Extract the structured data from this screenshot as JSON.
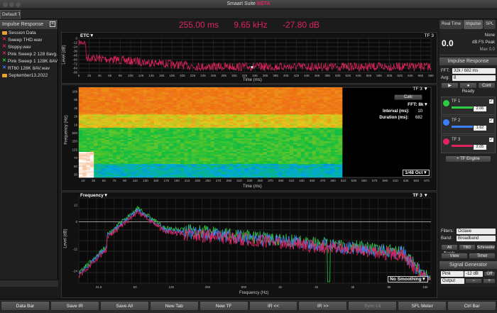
{
  "window": {
    "title": "Smaart Suite",
    "title_badge": "BETA"
  },
  "tabs": [
    "Default Tab"
  ],
  "readout": {
    "time": "255.00 ms",
    "freq": "9.65 kHz",
    "level": "-27.80 dB"
  },
  "left_panel": {
    "header": "Impulse Response",
    "items": [
      {
        "label": "Session Data",
        "marker": "folder",
        "color": "#e6a22e"
      },
      {
        "label": "Sweep THD.wav",
        "marker": "x",
        "color": "#e0245e"
      },
      {
        "label": "Sloppy.wav",
        "marker": "x",
        "color": "#e0245e"
      },
      {
        "label": "Pink Sweep 2 128 8avg.wav",
        "marker": "x",
        "color": "#e0245e"
      },
      {
        "label": "Pink Sweep 1 128K 8AVG.wav",
        "marker": "x",
        "color": "#2ecc40"
      },
      {
        "label": "RT60 128K 8AV.wav",
        "marker": "x",
        "color": "#3a7fff"
      },
      {
        "label": "September13.2022",
        "marker": "folder",
        "color": "#e6a22e"
      }
    ]
  },
  "etc_plot": {
    "title": "ETC",
    "trace": "TF 3",
    "ylabel": "Level (dB)",
    "xlabel": "Time (ms)",
    "yticks": [
      "0",
      "-12",
      "-24",
      "-36",
      "-48",
      "-60",
      "-72",
      "-84",
      "-96"
    ],
    "xticks": [
      "5",
      "25",
      "45",
      "65",
      "85",
      "105",
      "125",
      "145",
      "165",
      "185",
      "205",
      "225",
      "245",
      "265",
      "285",
      "305",
      "325",
      "345",
      "365",
      "385",
      "405",
      "425",
      "445",
      "465",
      "485",
      "505",
      "525",
      "545",
      "565",
      "585",
      "605",
      "625",
      "645",
      "665",
      "685"
    ]
  },
  "spectrograph": {
    "trace": "TF 3",
    "calc_label": "Calc",
    "fft_label": "FFT: 8k",
    "interval_label": "Interval (ms):",
    "interval_value": "10",
    "duration_label": "Duration (ms):",
    "duration_value": "682",
    "smoothing": "1/48 Oct",
    "ylabel": "Frequency (Hz)",
    "xlabel": "Time (ms)",
    "yticks": [
      "16k",
      "8k",
      "4k",
      "2k",
      "1k",
      "500",
      "250",
      "125",
      "70",
      "50",
      "30"
    ],
    "xticks": [
      "10",
      "30",
      "50",
      "70",
      "90",
      "110",
      "130",
      "150",
      "170",
      "190",
      "210",
      "230",
      "250",
      "270",
      "290",
      "310",
      "330",
      "350",
      "370",
      "390",
      "410",
      "430",
      "450",
      "470",
      "490",
      "510",
      "530",
      "550",
      "570",
      "590",
      "610",
      "630",
      "650",
      "670"
    ]
  },
  "freq_plot": {
    "title": "Frequency",
    "trace": "TF 3",
    "smoothing": "No Smoothing",
    "ylabel": "Level (dB)",
    "xlabel": "Frequency (Hz)",
    "yticks": [
      "12",
      "0",
      "-12",
      "-24"
    ],
    "xticks": [
      "31.5",
      "63",
      "125",
      "250",
      "500",
      "1k",
      "2k",
      "4k",
      "8k",
      "16k"
    ],
    "series_colors": [
      "#2ecc40",
      "#3a7fff",
      "#e0245e"
    ]
  },
  "right_panel": {
    "tabs": [
      "Real Time",
      "Impulse",
      "SPL"
    ],
    "spl": {
      "value": "0.0",
      "none": "None",
      "unit": "dB FS Peak",
      "max": "Max 0.0"
    },
    "section_title": "Impulse Response",
    "fft_label": "FFT:",
    "fft_value": "32k / 682 ms",
    "avg_label": "Avg:",
    "avg_value": "8",
    "cont_label": "Cont",
    "status": "Ready",
    "traces": [
      {
        "name": "TF 1",
        "value": "2.06",
        "color": "#2ecc40"
      },
      {
        "name": "TF 2",
        "value": "1.62",
        "color": "#3a7fff"
      },
      {
        "name": "TF 3",
        "value": "2.05",
        "color": "#e0245e"
      }
    ],
    "tf_engine": "+ TF Engine",
    "filters_label": "Filters:",
    "filters_value": "Octave",
    "band_label": "Band:",
    "band_value": "Broadband",
    "band_tabs": [
      "All Bands",
      "TBD",
      "Schroeder"
    ],
    "view_tabs": [
      "View",
      "Timer"
    ],
    "signal_generator": "Signal Generator",
    "gen_signal": "Pink Noise",
    "gen_level": "-12 dB",
    "gen_state": "Off",
    "gen_output": "Output"
  },
  "bottom_bar": [
    "Data Bar",
    "Save IR",
    "Save All",
    "New Tab",
    "New TF",
    "IR <<",
    "IR >>",
    "Sync Ld",
    "SFL Meter",
    "Ctrl Bar"
  ]
}
